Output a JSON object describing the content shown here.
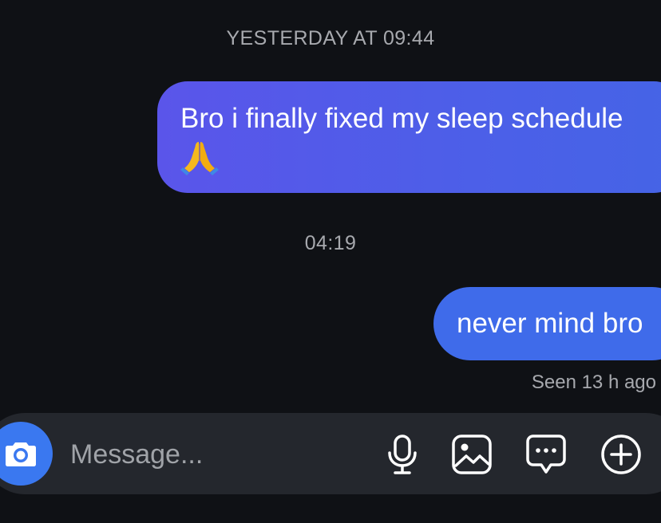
{
  "conversation": {
    "timestamp_1": "YESTERDAY AT 09:44",
    "message_1": {
      "text": "Bro i finally fixed my sleep schedule",
      "emoji": "folded-hands"
    },
    "timestamp_2": "04:19",
    "message_2": {
      "text": "never mind bro"
    },
    "seen_status": "Seen 13 h ago"
  },
  "composer": {
    "placeholder": "Message...",
    "value": "",
    "icons": [
      "camera-icon",
      "microphone-icon",
      "gallery-icon",
      "sticker-icon",
      "plus-icon"
    ]
  },
  "colors": {
    "background": "#0f1115",
    "bubble_1": "#4c5fe8",
    "bubble_2": "#3f6bea",
    "composer": "#24272d",
    "camera_button": "#3a78f0"
  }
}
